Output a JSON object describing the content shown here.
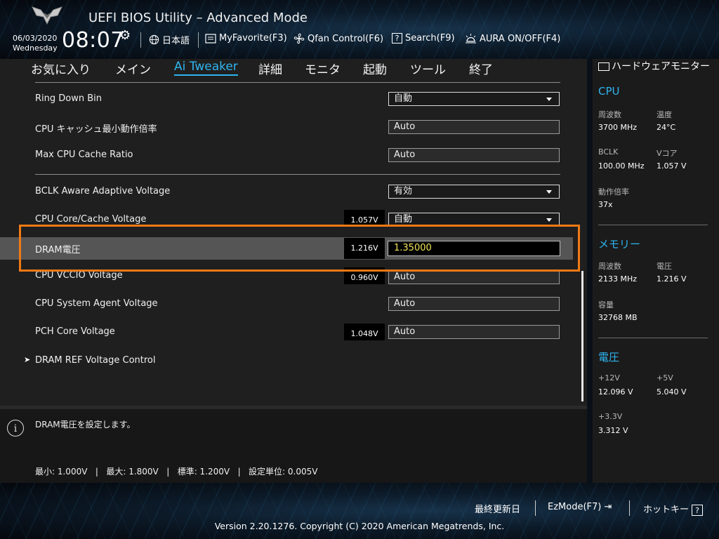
{
  "header": {
    "title": "UEFI BIOS Utility – Advanced Mode",
    "date": "06/03/2020",
    "weekday": "Wednesday",
    "time": "08:07",
    "buttons": [
      {
        "label": "日本語",
        "icon": "globe-icon"
      },
      {
        "label": "MyFavorite(F3)",
        "icon": "favorite-icon"
      },
      {
        "label": "Qfan Control(F6)",
        "icon": "fan-icon"
      },
      {
        "label": "Search(F9)",
        "icon": "search-icon"
      },
      {
        "label": "AURA ON/OFF(F4)",
        "icon": "aura-icon"
      }
    ]
  },
  "tabs": [
    {
      "label": "お気に入り",
      "active": false
    },
    {
      "label": "メイン",
      "active": false
    },
    {
      "label": "Ai Tweaker",
      "active": true
    },
    {
      "label": "詳細",
      "active": false
    },
    {
      "label": "モニタ",
      "active": false
    },
    {
      "label": "起動",
      "active": false
    },
    {
      "label": "ツール",
      "active": false
    },
    {
      "label": "終了",
      "active": false
    }
  ],
  "settings": {
    "ring_down_bin": {
      "label": "Ring Down Bin",
      "value": "自動"
    },
    "cpu_cache_min": {
      "label": "CPU キャッシュ最小動作倍率",
      "value": "Auto"
    },
    "max_cpu_cache": {
      "label": "Max CPU Cache Ratio",
      "value": "Auto"
    },
    "bclk_aware": {
      "label": "BCLK Aware Adaptive Voltage",
      "value": "有効"
    },
    "cpu_core_voltage": {
      "label": "CPU Core/Cache Voltage",
      "reading": "1.057V",
      "value": "自動"
    },
    "dram_voltage": {
      "label": "DRAM電圧",
      "reading": "1.216V",
      "value": "1.35000"
    },
    "cpu_vccio": {
      "label": "CPU VCCIO Voltage",
      "reading": "0.960V",
      "value": "Auto"
    },
    "cpu_sa": {
      "label": "CPU System Agent Voltage",
      "value": "Auto"
    },
    "pch_core": {
      "label": "PCH Core Voltage",
      "reading": "1.048V",
      "value": "Auto"
    },
    "dram_ref": {
      "label": "DRAM REF Voltage Control"
    }
  },
  "info": {
    "description": "DRAM電圧を設定します。",
    "limits": "最小: 1.000V   |   最大: 1.800V   |   標準: 1.200V   |   設定単位: 0.005V"
  },
  "hw_monitor": {
    "title": "ハードウェアモニター",
    "cpu": {
      "heading": "CPU",
      "freq_label": "周波数",
      "freq": "3700 MHz",
      "temp_label": "温度",
      "temp": "24°C",
      "bclk_label": "BCLK",
      "bclk": "100.00 MHz",
      "vcore_label": "Vコア",
      "vcore": "1.057 V",
      "ratio_label": "動作倍率",
      "ratio": "37x"
    },
    "memory": {
      "heading": "メモリー",
      "freq_label": "周波数",
      "freq": "2133 MHz",
      "volt_label": "電圧",
      "volt": "1.216 V",
      "cap_label": "容量",
      "cap": "32768 MB"
    },
    "voltage": {
      "heading": "電圧",
      "v12_label": "+12V",
      "v12": "12.096 V",
      "v5_label": "+5V",
      "v5": "5.040 V",
      "v33_label": "+3.3V",
      "v33": "3.312 V"
    }
  },
  "footer": {
    "last_modified": "最終更新日",
    "ezmode": "EzMode(F7)",
    "hotkeys": "ホットキー",
    "hotkey_box": "?",
    "copyright": "Version 2.20.1276. Copyright (C) 2020 American Megatrends, Inc."
  }
}
